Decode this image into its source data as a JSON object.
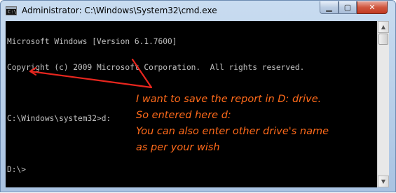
{
  "window": {
    "title": "Administrator: C:\\Windows\\System32\\cmd.exe",
    "app_icon_text": "C:\\"
  },
  "titlebar_buttons": {
    "minimize": "▁",
    "maximize": "▢",
    "close": "✕"
  },
  "console": {
    "lines": [
      "Microsoft Windows [Version 6.1.7600]",
      "Copyright (c) 2009 Microsoft Corporation.  All rights reserved.",
      "",
      "C:\\Windows\\system32>d:",
      "",
      "D:\\>"
    ]
  },
  "annotation": {
    "lines": [
      "I want to save the report in D: drive.",
      "So entered here d:",
      "You can also enter other drive's name",
      "as per your wish"
    ],
    "color": "#ff6a1a",
    "arrow_color": "#e8261e"
  },
  "scrollbar": {
    "up": "▲",
    "down": "▼"
  }
}
